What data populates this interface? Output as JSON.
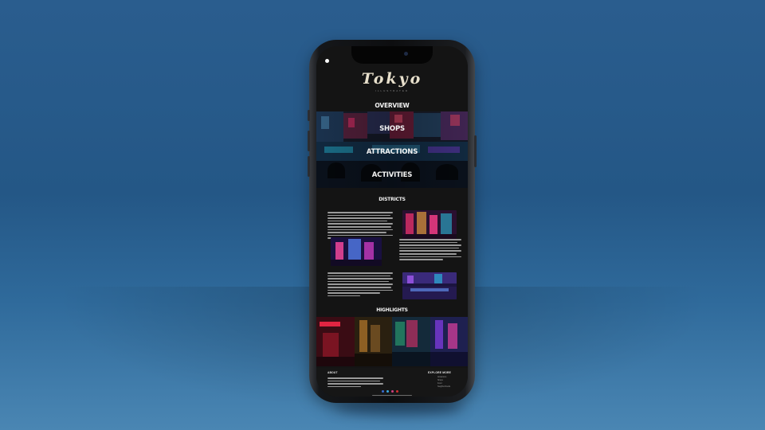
{
  "site": {
    "logo_text": "Tokyo",
    "logo_subtitle": "ILLUSTRATED"
  },
  "nav": {
    "items": [
      {
        "label": "OVERVIEW"
      },
      {
        "label": "SHOPS"
      },
      {
        "label": "ATTRACTIONS"
      },
      {
        "label": "ACTIVITIES"
      }
    ]
  },
  "sections": {
    "districts_title": "DISTRICTS",
    "highlights_title": "HIGHLIGHTS"
  },
  "footer": {
    "about_title": "ABOUT",
    "explore_title": "EXPLORE MORE",
    "explore_links": [
      "Attractions",
      "Shops",
      "Food",
      "Neighborhoods"
    ]
  },
  "colors": {
    "background_top": "#2a5d8e",
    "phone_frame": "#0d0e10",
    "screen_bg": "#141414",
    "neon_pink": "#e0306a",
    "neon_cyan": "#28c8e8",
    "neon_purple": "#7a3ad8"
  }
}
